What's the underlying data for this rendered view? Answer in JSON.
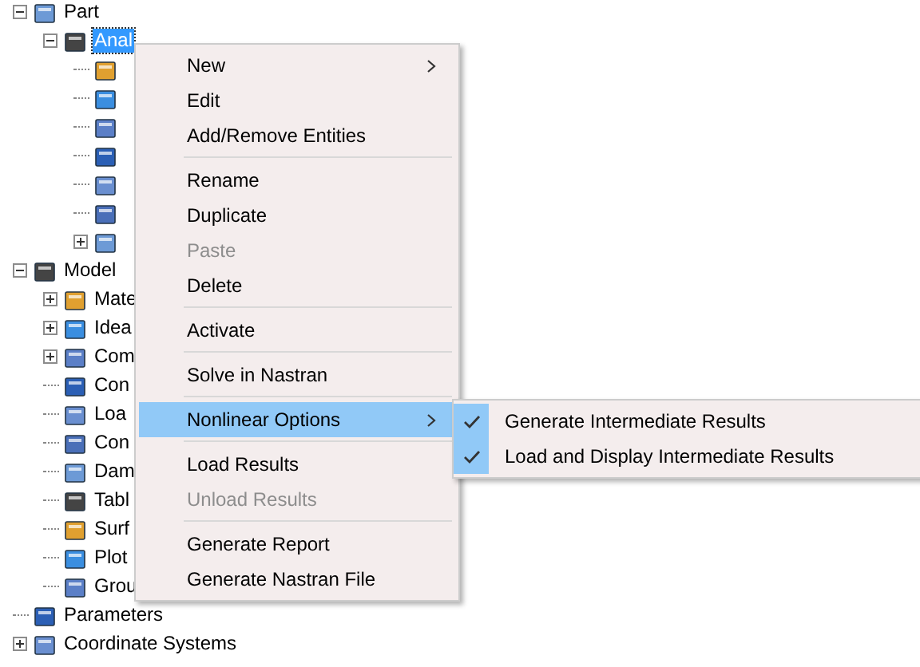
{
  "tree": [
    {
      "label": "Part",
      "expanded": true,
      "selected": false,
      "children": [
        {
          "label": "Anal",
          "expanded": true,
          "selected": true,
          "children": [
            {
              "selected": false
            },
            {
              "selected": false
            },
            {
              "selected": false
            },
            {
              "selected": false
            },
            {
              "selected": false
            },
            {
              "selected": false
            },
            {
              "expanded": false,
              "selected": false
            }
          ]
        }
      ]
    },
    {
      "label": "Model",
      "expanded": true,
      "selected": false,
      "children": [
        {
          "label": "Mate",
          "expanded": false,
          "selected": false
        },
        {
          "label": "Idea",
          "expanded": false,
          "selected": false
        },
        {
          "label": "Com",
          "expanded": false,
          "selected": false
        },
        {
          "label": "Con",
          "selected": false
        },
        {
          "label": "Loa",
          "selected": false
        },
        {
          "label": "Con",
          "selected": false
        },
        {
          "label": "Dam",
          "selected": false
        },
        {
          "label": "Tabl",
          "selected": false
        },
        {
          "label": "Surf",
          "selected": false
        },
        {
          "label": "Plot",
          "selected": false
        },
        {
          "label": "Grou",
          "selected": false
        }
      ]
    },
    {
      "label": "Parameters",
      "selected": false
    },
    {
      "label": "Coordinate Systems",
      "expanded": false,
      "selected": false
    }
  ],
  "context_menu": [
    {
      "kind": "item",
      "label": "New",
      "disabled": false,
      "submenu": true,
      "selected": false
    },
    {
      "kind": "item",
      "label": "Edit",
      "disabled": false,
      "submenu": false,
      "selected": false
    },
    {
      "kind": "item",
      "label": "Add/Remove Entities",
      "disabled": false,
      "submenu": false,
      "selected": false
    },
    {
      "kind": "separator"
    },
    {
      "kind": "item",
      "label": "Rename",
      "disabled": false,
      "submenu": false,
      "selected": false
    },
    {
      "kind": "item",
      "label": "Duplicate",
      "disabled": false,
      "submenu": false,
      "selected": false
    },
    {
      "kind": "item",
      "label": "Paste",
      "disabled": true,
      "submenu": false,
      "selected": false
    },
    {
      "kind": "item",
      "label": "Delete",
      "disabled": false,
      "submenu": false,
      "selected": false
    },
    {
      "kind": "separator"
    },
    {
      "kind": "item",
      "label": "Activate",
      "disabled": false,
      "submenu": false,
      "selected": false
    },
    {
      "kind": "separator"
    },
    {
      "kind": "item",
      "label": "Solve in Nastran",
      "disabled": false,
      "submenu": false,
      "selected": false
    },
    {
      "kind": "separator"
    },
    {
      "kind": "item",
      "label": "Nonlinear Options",
      "disabled": false,
      "submenu": true,
      "selected": true
    },
    {
      "kind": "separator"
    },
    {
      "kind": "item",
      "label": "Load Results",
      "disabled": false,
      "submenu": false,
      "selected": false
    },
    {
      "kind": "item",
      "label": "Unload Results",
      "disabled": true,
      "submenu": false,
      "selected": false
    },
    {
      "kind": "separator"
    },
    {
      "kind": "item",
      "label": "Generate Report",
      "disabled": false,
      "submenu": false,
      "selected": false
    },
    {
      "kind": "item",
      "label": "Generate Nastran File",
      "disabled": false,
      "submenu": false,
      "selected": false
    }
  ],
  "submenu": [
    {
      "label": "Generate Intermediate Results",
      "checked": true
    },
    {
      "label": "Load and Display Intermediate Results",
      "checked": true
    }
  ]
}
